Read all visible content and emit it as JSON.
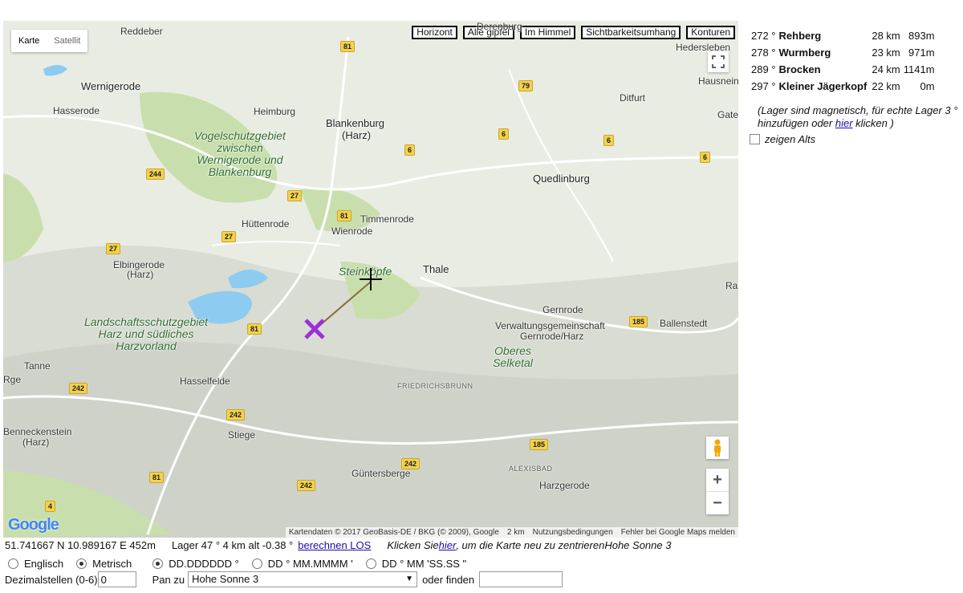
{
  "map": {
    "type_tabs": [
      "Karte",
      "Satellit"
    ],
    "toolbar": [
      "Horizont",
      "Alle gipfel",
      "Im Himmel",
      "Sichtbarkeitsumhang",
      "Konturen"
    ],
    "places": [
      {
        "name": "Reddeber",
        "k": "t"
      },
      {
        "name": "Wernigerode",
        "k": "big"
      },
      {
        "name": "Hasserode",
        "k": "t"
      },
      {
        "name": "Heimburg",
        "k": "t"
      },
      {
        "name": "Blankenburg",
        "k": "big"
      },
      {
        "name": "(Harz)",
        "k": "big"
      },
      {
        "name": "Derenburg",
        "k": "t"
      },
      {
        "name": "Ditfurt",
        "k": "t"
      },
      {
        "name": "Quedlinburg",
        "k": "big"
      },
      {
        "name": "Hedersleben",
        "k": "t"
      },
      {
        "name": "Hausnein",
        "k": "t"
      },
      {
        "name": "Gate",
        "k": "t"
      },
      {
        "name": "Hüttenrode",
        "k": "t"
      },
      {
        "name": "Timmenrode",
        "k": "t"
      },
      {
        "name": "Wienrode",
        "k": "t"
      },
      {
        "name": "Elbingerode",
        "k": "t"
      },
      {
        "name": "(Harz)",
        "k": "t"
      },
      {
        "name": "Thale",
        "k": "big"
      },
      {
        "name": "Gernrode",
        "k": "t"
      },
      {
        "name": "Ballenstedt",
        "k": "t"
      },
      {
        "name": "Verwaltungsgemeinschaft",
        "k": "t"
      },
      {
        "name": "Gernrode/Harz",
        "k": "t"
      },
      {
        "name": "Tanne",
        "k": "t"
      },
      {
        "name": "Hasselfelde",
        "k": "t"
      },
      {
        "name": "FRIEDRICHSBRUNN",
        "k": "small"
      },
      {
        "name": "Benneckenstein",
        "k": "t"
      },
      {
        "name": "(Harz)",
        "k": "t"
      },
      {
        "name": "Stiege",
        "k": "t"
      },
      {
        "name": "Güntersberge",
        "k": "t"
      },
      {
        "name": "ALEXISBAD",
        "k": "small"
      },
      {
        "name": "Harzgerode",
        "k": "t"
      },
      {
        "name": "Rge",
        "k": "t"
      },
      {
        "name": "Ra",
        "k": "t"
      }
    ],
    "nature_areas": [
      "Vogelschutzgebiet zwischen Wernigerode und Blankenburg",
      "Steinköpfe",
      "Landschaftsschutzgebiet Harz und südliches Harzvorland",
      "Oberes Selketal"
    ],
    "road_shields": [
      "81",
      "79",
      "6",
      "6",
      "6",
      "6",
      "244",
      "27",
      "81",
      "27",
      "27",
      "81",
      "185",
      "242",
      "242",
      "242",
      "185",
      "242",
      "81",
      "4"
    ],
    "attribution": [
      "Kartendaten © 2017 GeoBasis-DE / BKG (© 2009), Google",
      "2 km",
      "Nutzungsbedingungen",
      "Fehler bei Google Maps melden"
    ],
    "logo": "Google"
  },
  "results": {
    "rows": [
      {
        "bearing": "272 °",
        "name": "Rehberg",
        "dist": "28 km",
        "alt": "893m"
      },
      {
        "bearing": "278 °",
        "name": "Wurmberg",
        "dist": "23 km",
        "alt": "971m"
      },
      {
        "bearing": "289 °",
        "name": "Brocken",
        "dist": "24 km",
        "alt": "1141m"
      },
      {
        "bearing": "297 °",
        "name": "Kleiner Jägerkopf",
        "dist": "22 km",
        "alt": "0m"
      }
    ],
    "note_before": "(Lager sind magnetisch, für echte Lager 3 ° hinzufügen oder ",
    "note_link": "hier",
    "note_after": " klicken )",
    "show_alts": "zeigen Alts"
  },
  "status": {
    "coords": "51.741667 N 10.989167 E 452m",
    "bearing": "Lager 47 ° 4 km alt -0.38 °",
    "los_link": "berechnen LOS",
    "click_before": "Klicken Sie ",
    "click_link": "hier",
    "click_after": " , um die Karte neu zu zentrieren",
    "place": "Hohe Sonne 3"
  },
  "options": {
    "units": [
      "Englisch",
      "Metrisch"
    ],
    "formats": [
      "DD.DDDDDD °",
      "DD ° MM.MMMM '",
      "DD ° MM 'SS.SS \""
    ],
    "decimals_label": "Dezimalstellen (0-6)",
    "decimals_value": "0",
    "pan_label": "Pan zu",
    "pan_value": "Hohe Sonne 3",
    "find_label": "oder finden",
    "find_value": ""
  },
  "colors": {
    "forest": "#cfe0b8",
    "water": "#8ecbf0",
    "road": "#ffffff",
    "shield": "#f4d24a",
    "marker": "#9b30d9"
  }
}
